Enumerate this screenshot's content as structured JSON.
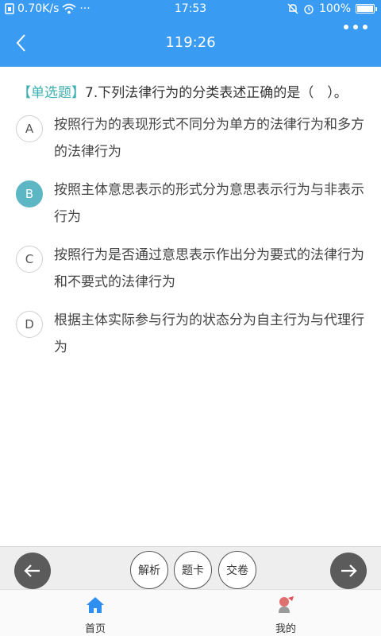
{
  "status": {
    "network_speed": "0.70K/s",
    "more": "···",
    "time": "17:53",
    "battery": "100%"
  },
  "header": {
    "timer": "119:26"
  },
  "question": {
    "type_tag": "【单选题】",
    "text": "7.下列法律行为的分类表述正确的是（　）。"
  },
  "options": [
    {
      "letter": "A",
      "text": "按照行为的表现形式不同分为单方的法律行为和多方的法律行为",
      "selected": false
    },
    {
      "letter": "B",
      "text": "按照主体意思表示的形式分为意思表示行为与非表示行为",
      "selected": true
    },
    {
      "letter": "C",
      "text": "按照行为是否通过意思表示作出分为要式的法律行为和不要式的法律行为",
      "selected": false
    },
    {
      "letter": "D",
      "text": "根据主体实际参与行为的状态分为自主行为与代理行为",
      "selected": false
    }
  ],
  "toolbar": {
    "analysis": "解析",
    "answer_card": "题卡",
    "submit": "交卷"
  },
  "tabs": {
    "home": "首页",
    "mine": "我的"
  },
  "colors": {
    "primary": "#3a9bf2",
    "tag": "#3cb0b0",
    "selected": "#5cb6c4",
    "arrow_button": "#5b5b5b"
  }
}
